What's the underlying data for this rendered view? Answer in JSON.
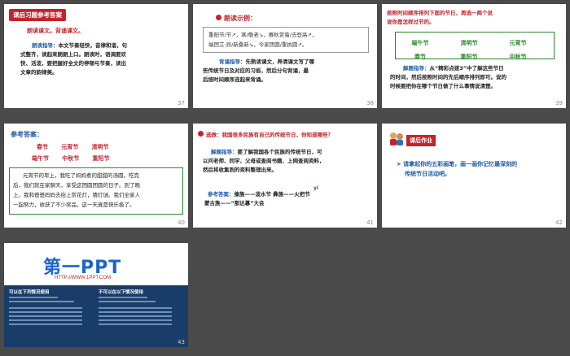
{
  "slides": {
    "s37": {
      "number": "37",
      "banner": "课后习题参考答案",
      "instruction": "朗读课文。背诵课文。",
      "guide_label": "朗读指导：",
      "guide_text_1": "本文节奏轻快，音律和谐，句",
      "guide_text_2": "式整齐，读起来朗朗上口。朗读时，语调要欢",
      "guide_text_3": "快、活泼，要把握好全文的停顿与节奏，读出",
      "guide_text_4": "文章的韵律美。"
    },
    "s38": {
      "number": "38",
      "title": "朗读示例：",
      "example_line_1": "重阳节/节↗，寒/敬老↘，赛秋赏菊/去登高↗，",
      "example_line_2": "端团艾·异/新桑新↘，今家团圆/重执圆↗。",
      "guide_label": "背诵指导：",
      "guide_text_1": "先熟读课文，弄清课文写了哪",
      "guide_text_2": "些传统节日及对应的习俗，然后分句背诵，最",
      "guide_text_3": "后按时间顺序连起来背诵。"
    },
    "s39": {
      "number": "39",
      "prompt_1": "按照时间顺序排列下面的节日，再选一两个说",
      "prompt_2": "说你是怎样过节的。",
      "festivals": [
        "端午节",
        "清明节",
        "元宵节",
        "春节",
        "重阳节",
        "中秋节"
      ],
      "guide_label": "解题指导：",
      "guide_text_1": "从“精彩点拨3”中了解这些节日",
      "guide_text_2": "的时间，然后按照时间的先后顺序排列即可。说的",
      "guide_text_3": "时候要把你在哪个节日做了什么事情说清楚。"
    },
    "s40": {
      "number": "40",
      "title": "参考答案：",
      "order_row_1": [
        "春节",
        "元宵节",
        "清明节"
      ],
      "order_row_2": [
        "端午节",
        "中秋节",
        "重阳节"
      ],
      "essay_1": "元宵节的早上，我吃了妈妈煮的甜甜的汤圆。吃完",
      "essay_2": "后，我们就在家聊天，享受这团圆团圆的日子。到了晚",
      "essay_3": "上，我和爸爸妈妈去街上赏花灯，猜灯谜。我们全家人",
      "essay_4": "一起努力，收获了不少奖品，这一天真是快乐极了。"
    },
    "s41": {
      "number": "41",
      "prompt": "选做：我国很多民族有自己的传统节日，你知道哪些？",
      "guide_label": "解题指导：",
      "guide_text_1": "要了解我国各个民族的传统节日，可",
      "guide_text_2": "以问老师、同学、父母或查阅书籍、上网查阅资料，",
      "guide_text_3": "然后将收集到的资料整理出来。",
      "answer_label": "参考答案：",
      "pinyin": "yí",
      "answer_1": "傣族——泼水节     彝族——火把节",
      "answer_2": "蒙古族——“那达慕”大会"
    },
    "s42": {
      "number": "42",
      "header": "课后作业",
      "task_1": "请拿起你的五彩画笔，画一画你记忆最深刻的",
      "task_2": "传统节日活动吧。"
    },
    "s43": {
      "number": "43",
      "logo_main": "第一PPT",
      "logo_url": "HTTP://WWW.1PPT.COM",
      "col_left_title": "可以在下列情况使用",
      "col_right_title": "不可以在以下情况使用"
    }
  },
  "colors": {
    "background": "#4a4a4a",
    "red": "#c0252a",
    "blue": "#1c5aa8",
    "green": "#2a8a2a"
  }
}
